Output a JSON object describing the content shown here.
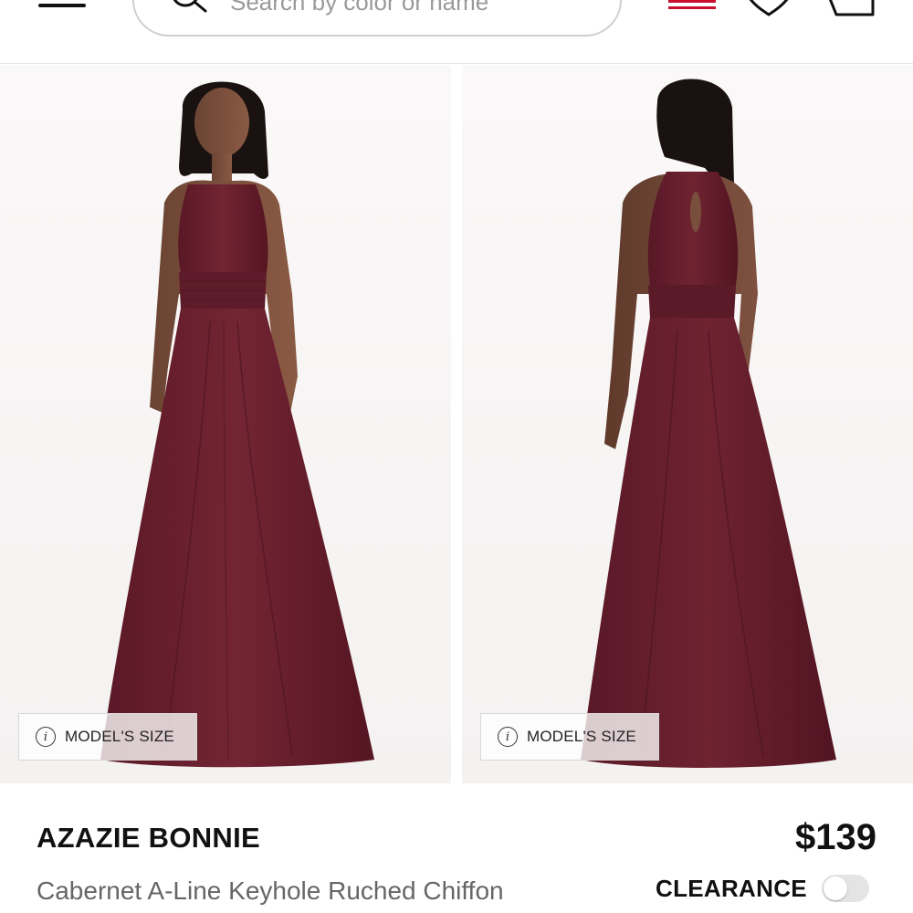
{
  "header": {
    "search_placeholder": "Search by color or name"
  },
  "gallery": {
    "images": [
      {
        "view": "front",
        "model_size_label": "MODEL'S SIZE"
      },
      {
        "view": "back",
        "model_size_label": "MODEL'S SIZE"
      }
    ],
    "dress_color": "#6b1f2e"
  },
  "product": {
    "brand": "AZAZIE BONNIE",
    "price": "$139",
    "description": "Cabernet A-Line Keyhole Ruched Chiffon",
    "clearance_label": "CLEARANCE",
    "clearance_on": false
  },
  "colors": {
    "flag_red": "#c8102e",
    "text": "#111111",
    "muted": "#666666"
  }
}
